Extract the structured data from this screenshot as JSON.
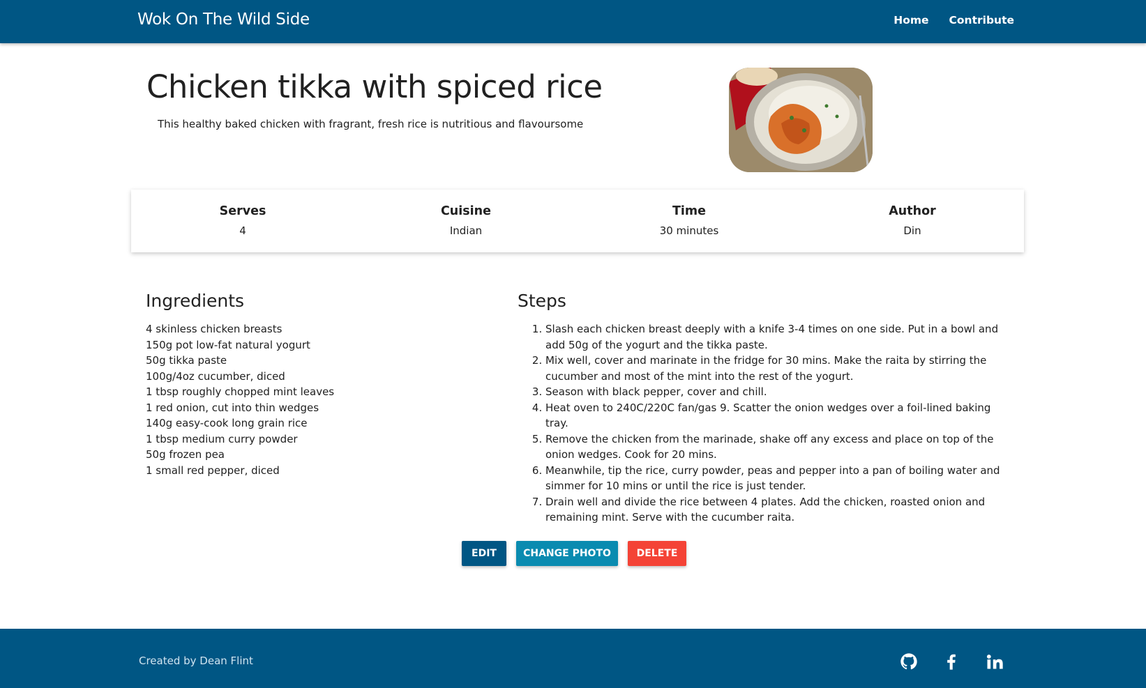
{
  "header": {
    "brand": "Wok On The Wild Side",
    "nav": [
      {
        "label": "Home"
      },
      {
        "label": "Contribute"
      }
    ]
  },
  "recipe": {
    "title": "Chicken tikka with spiced rice",
    "description": "This healthy baked chicken with fragrant, fresh rice is nutritious and flavoursome",
    "info": {
      "serves": {
        "label": "Serves",
        "value": "4"
      },
      "cuisine": {
        "label": "Cuisine",
        "value": "Indian"
      },
      "time": {
        "label": "Time",
        "value": "30 minutes"
      },
      "author": {
        "label": "Author",
        "value": "Din"
      }
    },
    "ingredients_heading": "Ingredients",
    "ingredients": [
      "4 skinless chicken breasts",
      "150g pot low-fat natural yogurt",
      "50g tikka paste",
      "100g/4oz cucumber, diced",
      "1 tbsp roughly chopped mint leaves",
      "1 red onion, cut into thin wedges",
      "140g easy-cook long grain rice",
      "1 tbsp medium curry powder",
      "50g frozen pea",
      "1 small red pepper, diced"
    ],
    "steps_heading": "Steps",
    "steps": [
      "Slash each chicken breast deeply with a knife 3-4 times on one side. Put in a bowl and add 50g of the yogurt and the tikka paste.",
      "Mix well, cover and marinate in the fridge for 30 mins. Make the raita by stirring the cucumber and most of the mint into the rest of the yogurt.",
      "Season with black pepper, cover and chill.",
      "Heat oven to 240C/220C fan/gas 9. Scatter the onion wedges over a foil-lined baking tray.",
      "Remove the chicken from the marinade, shake off any excess and place on top of the onion wedges. Cook for 20 mins.",
      "Meanwhile, tip the rice, curry powder, peas and pepper into a pan of boiling water and simmer for 10 mins or until the rice is just tender.",
      "Drain well and divide the rice between 4 plates. Add the chicken, roasted onion and remaining mint. Serve with the cucumber raita."
    ]
  },
  "actions": {
    "edit_label": "EDIT",
    "change_photo_label": "CHANGE PHOTO",
    "delete_label": "DELETE"
  },
  "footer": {
    "credit": "Created by Dean Flint",
    "social_icons": [
      "github-icon",
      "facebook-icon",
      "linkedin-icon"
    ]
  },
  "colors": {
    "primary": "#005684",
    "secondary": "#0a8bb0",
    "danger": "#f44336"
  }
}
